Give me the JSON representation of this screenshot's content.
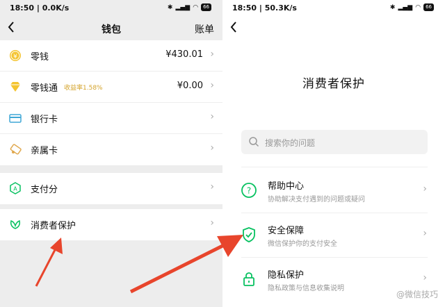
{
  "left": {
    "status": {
      "time": "18:50",
      "speed": "0.0K/s",
      "battery": "66"
    },
    "nav": {
      "title": "钱包",
      "right": "账单"
    },
    "group1": [
      {
        "icon": "coin-icon",
        "label": "零钱",
        "value": "¥430.01"
      },
      {
        "icon": "diamond-icon",
        "label": "零钱通",
        "badge": "收益率1.58%",
        "value": "¥0.00"
      },
      {
        "icon": "card-icon",
        "label": "银行卡",
        "value": ""
      },
      {
        "icon": "family-card-icon",
        "label": "亲属卡",
        "value": ""
      }
    ],
    "group2": [
      {
        "icon": "score-icon",
        "label": "支付分"
      }
    ],
    "group3": [
      {
        "icon": "leaf-shield-icon",
        "label": "消费者保护"
      }
    ]
  },
  "right": {
    "status": {
      "time": "18:50",
      "speed": "50.3K/s",
      "battery": "66"
    },
    "title": "消费者保护",
    "search": {
      "placeholder": "搜索你的问题"
    },
    "items": [
      {
        "icon": "help-icon",
        "title": "帮助中心",
        "subtitle": "协助解决支付遇到的问题或疑问"
      },
      {
        "icon": "shield-icon",
        "title": "安全保障",
        "subtitle": "微信保护你的支付安全"
      },
      {
        "icon": "lock-icon",
        "title": "隐私保护",
        "subtitle": "隐私政策与信息收集说明"
      }
    ],
    "watermark": "@微信技巧"
  },
  "colors": {
    "green": "#07c160",
    "red": "#e8452c",
    "gold": "#e6b422"
  }
}
